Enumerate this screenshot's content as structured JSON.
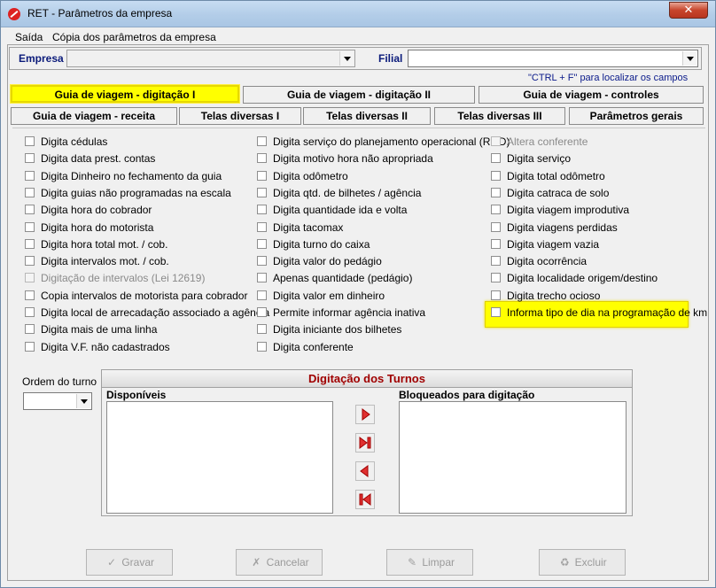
{
  "window": {
    "title": "RET - Parâmetros da empresa",
    "close": "✕"
  },
  "menu": [
    {
      "label": "Saída"
    },
    {
      "label": "Cópia dos parâmetros da empresa"
    }
  ],
  "empresa": {
    "label": "Empresa",
    "value": ""
  },
  "filial": {
    "label": "Filial",
    "value": ""
  },
  "hint": "\"CTRL + F\" para localizar os campos",
  "tabs_row1": [
    {
      "label": "Guia de viagem - digitação I",
      "active": true
    },
    {
      "label": "Guia de viagem - digitação II"
    },
    {
      "label": "Guia de viagem - controles"
    }
  ],
  "tabs_row2": [
    {
      "label": "Guia de viagem - receita"
    },
    {
      "label": "Telas diversas I"
    },
    {
      "label": "Telas diversas II"
    },
    {
      "label": "Telas diversas III"
    },
    {
      "label": "Parâmetros gerais"
    }
  ],
  "checkbox_col1": [
    {
      "label": "Digita cédulas"
    },
    {
      "label": "Digita data prest. contas"
    },
    {
      "label": "Digita Dinheiro no fechamento da guia"
    },
    {
      "label": "Digita guias não programadas na escala"
    },
    {
      "label": "Digita hora do cobrador"
    },
    {
      "label": "Digita hora do motorista"
    },
    {
      "label": "Digita hora total mot. / cob."
    },
    {
      "label": "Digita  intervalos mot. / cob."
    },
    {
      "label": "Digitação de intervalos (Lei 12619)",
      "disabled": true
    },
    {
      "label": "Copia intervalos de motorista para cobrador"
    },
    {
      "label": "Digita local de arrecadação associado a agência"
    },
    {
      "label": "Digita mais de uma linha"
    },
    {
      "label": "Digita V.F. não cadastrados"
    }
  ],
  "checkbox_col2": [
    {
      "label": "Digita serviço do planejamento operacional (ROD)"
    },
    {
      "label": "Digita motivo hora não apropriada"
    },
    {
      "label": "Digita odômetro"
    },
    {
      "label": "Digita qtd. de bilhetes / agência"
    },
    {
      "label": "Digita quantidade ida e volta"
    },
    {
      "label": "Digita tacomax"
    },
    {
      "label": "Digita turno do caixa"
    },
    {
      "label": "Digita valor do pedágio"
    },
    {
      "label": "Apenas quantidade (pedágio)"
    },
    {
      "label": "Digita valor em dinheiro"
    },
    {
      "label": "Permite informar agência inativa"
    },
    {
      "label": "Digita iniciante dos bilhetes"
    },
    {
      "label": "Digita conferente"
    }
  ],
  "checkbox_col3": [
    {
      "label": "Altera conferente",
      "disabled": true
    },
    {
      "label": "Digita serviço"
    },
    {
      "label": "Digita total odômetro"
    },
    {
      "label": "Digita catraca de solo"
    },
    {
      "label": "Digita viagem improdutiva"
    },
    {
      "label": "Digita viagens perdidas"
    },
    {
      "label": "Digita viagem vazia"
    },
    {
      "label": "Digita ocorrência"
    },
    {
      "label": "Digita localidade origem/destino"
    },
    {
      "label": "Digita trecho ocioso"
    },
    {
      "label": "Informa tipo de dia na programação de km"
    }
  ],
  "ordem": {
    "label": "Ordem do turno",
    "value": ""
  },
  "turnos": {
    "title": "Digitação dos Turnos",
    "disponiveis": "Disponíveis",
    "bloqueados": "Bloqueados para digitação"
  },
  "buttons": [
    {
      "label": "Gravar",
      "icon": "check-icon"
    },
    {
      "label": "Cancelar",
      "icon": "x-icon"
    },
    {
      "label": "Limpar",
      "icon": "eraser-icon"
    },
    {
      "label": "Excluir",
      "icon": "trash-icon"
    }
  ],
  "colors": {
    "highlight": "#ffff00",
    "accent_red": "#a00000",
    "label_blue": "#0a1a7a"
  }
}
